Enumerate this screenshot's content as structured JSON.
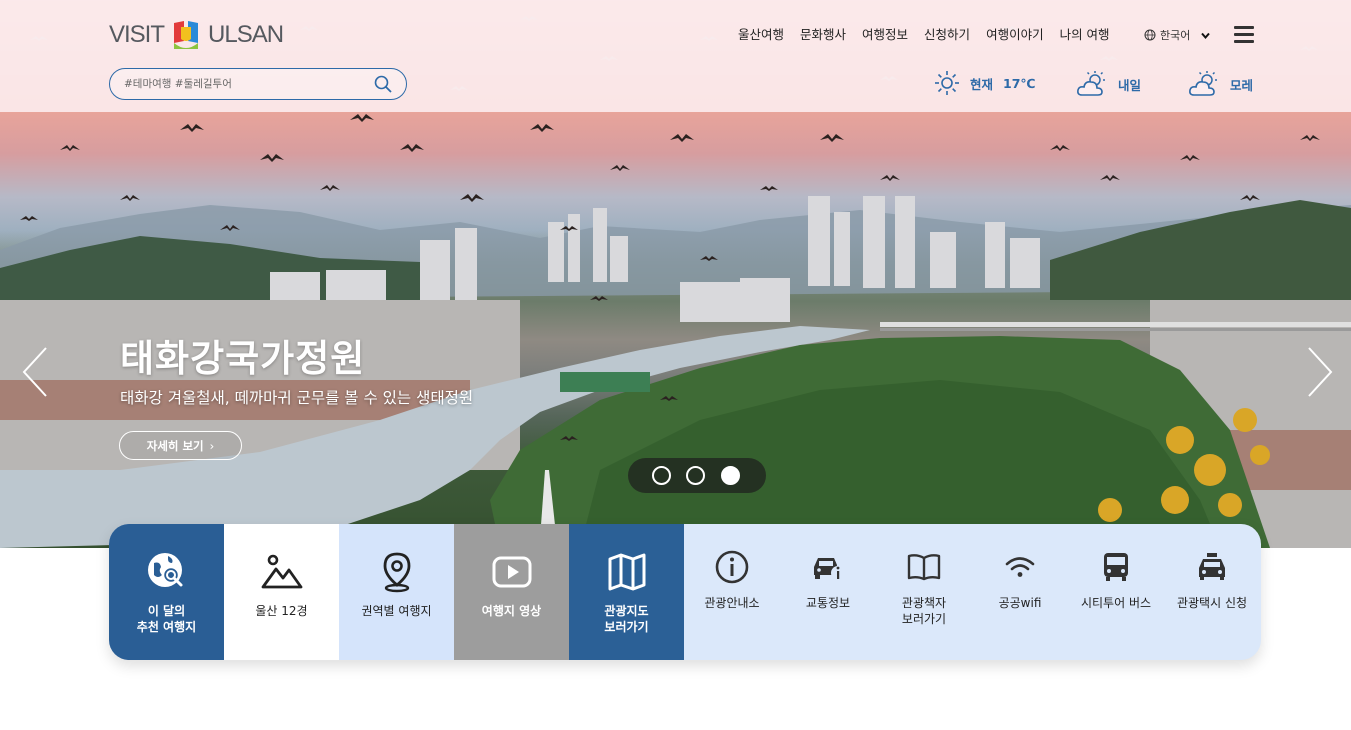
{
  "brand": {
    "logo_left": "VISIT",
    "logo_right": "ULSAN"
  },
  "nav": {
    "items": [
      "울산여행",
      "문화행사",
      "여행정보",
      "신청하기",
      "여행이야기",
      "나의 여행"
    ],
    "language": "한국어"
  },
  "search": {
    "placeholder": "#테마여행 #둘레길투어"
  },
  "weather": {
    "now_label": "현재",
    "now_temp": "17℃",
    "tomorrow_label": "내일",
    "after_label": "모레"
  },
  "slide": {
    "title": "태화강국가정원",
    "description": "태화강 겨울철새, 떼까마귀 군무를 볼 수 있는 생태정원",
    "more_label": "자세히 보기",
    "pager": {
      "count": 3,
      "active_index": 3
    }
  },
  "quick_menu": {
    "primary": [
      {
        "label": "이 달의\n추천 여행지",
        "icon": "globe-search-icon"
      },
      {
        "label": "울산 12경",
        "icon": "mountain-icon"
      },
      {
        "label": "권역별 여행지",
        "icon": "map-pin-icon"
      },
      {
        "label": "여행지 영상",
        "icon": "play-video-icon"
      },
      {
        "label": "관광지도\n보러가기",
        "icon": "folded-map-icon"
      }
    ],
    "secondary": [
      {
        "label": "관광안내소",
        "icon": "info-icon"
      },
      {
        "label": "교통정보",
        "icon": "car-info-icon"
      },
      {
        "label": "관광책자\n보러가기",
        "icon": "book-icon"
      },
      {
        "label": "공공wifi",
        "icon": "wifi-icon"
      },
      {
        "label": "시티투어 버스",
        "icon": "bus-icon"
      },
      {
        "label": "관광택시 신청",
        "icon": "taxi-icon"
      }
    ]
  },
  "colors": {
    "accent": "#2d6aa8",
    "navy": "#2a5e95",
    "light_blue": "#dbe8fa",
    "gray": "#9d9d9d"
  }
}
